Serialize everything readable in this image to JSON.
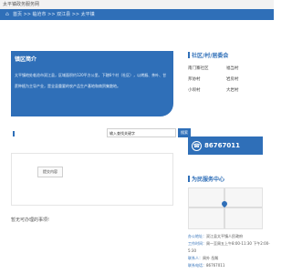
{
  "header": {
    "site_title": "太平镇政务服务网"
  },
  "breadcrumb": {
    "home_icon": "home-icon",
    "path": "首页 >> 临沧市 >> 双江县 >> 太平镇"
  },
  "intro": {
    "title": "镇区简介",
    "text": "太平镇地处临沧市双江县，区域面积约120平方公里，下辖6个村（社区），以烤烟、茶叶、甘蔗种植为主导产业，是全县重要的农产品生产基地和商贸集散地。"
  },
  "search": {
    "placeholder": "输入查找关键字",
    "button": "搜索"
  },
  "form": {
    "submit": "提交内容"
  },
  "notice": "暂无可办理的事项!",
  "side_villages": {
    "title": "社区/村/居委会",
    "items": [
      "南门寨社区",
      "福当村",
      "邦协村",
      "岩房村",
      "小坝村",
      "大岩村"
    ]
  },
  "phone": {
    "icon": "phone-icon",
    "number": "86767011"
  },
  "service_center": {
    "title": "为民服务中心",
    "address_label": "办公地址：",
    "address": "双江县太平镇人民政府",
    "hours_label": "工作时间：",
    "hours": "周一至周五上午8:00-11:30 下午2:00-5:30",
    "contact_label": "联系人：",
    "contact": "周外 岳粼",
    "tel_label": "联系电话：",
    "tel": "86767011"
  }
}
